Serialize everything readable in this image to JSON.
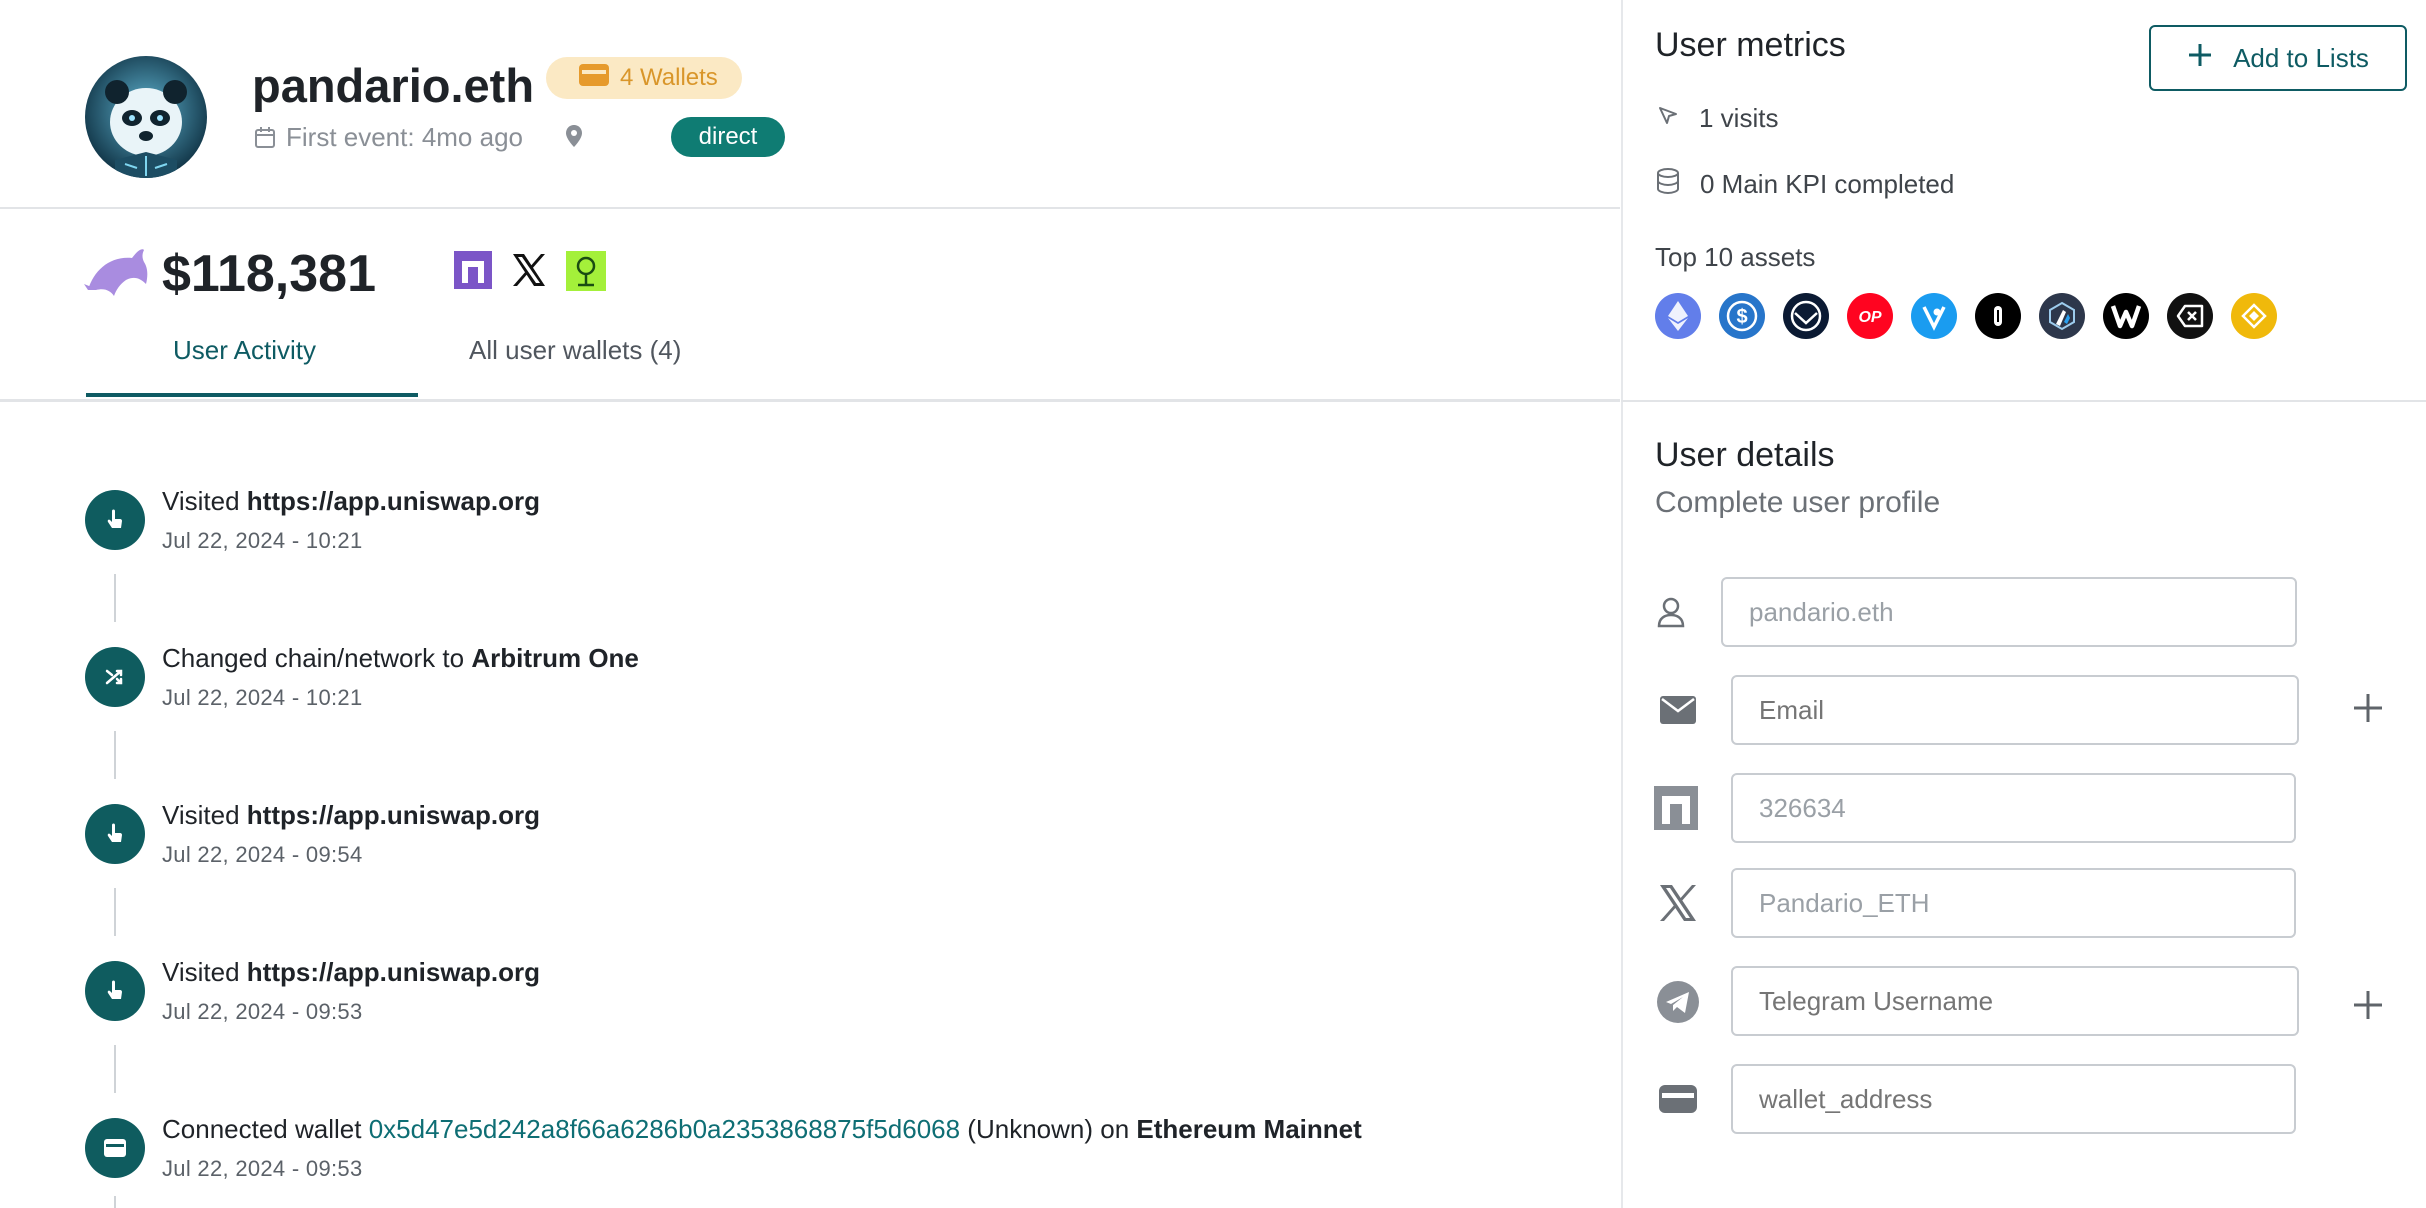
{
  "header": {
    "title": "pandario.eth",
    "wallets_badge": "4 Wallets",
    "first_event": "First event: 4mo ago",
    "source_badge": "direct"
  },
  "summary": {
    "amount": "$118,381",
    "social_icons": [
      "nouns-icon",
      "x-icon",
      "green-tree-icon"
    ]
  },
  "tabs": [
    {
      "label": "User Activity",
      "active": true
    },
    {
      "label": "All user wallets (4)",
      "active": false
    }
  ],
  "events": [
    {
      "icon": "click-icon",
      "prefix": "Visited ",
      "bold": "https://app.uniswap.org",
      "date": "Jul 22, 2024 - 10:21"
    },
    {
      "icon": "shuffle-icon",
      "prefix": "Changed chain/network to ",
      "bold": "Arbitrum One",
      "date": "Jul 22, 2024 - 10:21"
    },
    {
      "icon": "click-icon",
      "prefix": "Visited ",
      "bold": "https://app.uniswap.org",
      "date": "Jul 22, 2024 - 09:54"
    },
    {
      "icon": "click-icon",
      "prefix": "Visited ",
      "bold": "https://app.uniswap.org",
      "date": "Jul 22, 2024 - 09:53"
    },
    {
      "icon": "wallet-icon",
      "prefix": "Connected wallet ",
      "link": "0x5d47e5d242a8f66a6286b0a2353868875f5d6068",
      "middle": " (Unknown) on ",
      "bold": "Ethereum Mainnet",
      "date": "Jul 22, 2024 - 09:53"
    }
  ],
  "metrics": {
    "heading": "User metrics",
    "add_button": "Add to Lists",
    "visits": "1 visits",
    "kpi": "0 Main KPI completed",
    "top_assets_label": "Top 10 assets",
    "assets": [
      {
        "name": "ethereum-icon",
        "color": "#627eea"
      },
      {
        "name": "usdc-icon",
        "color": "#2775ca"
      },
      {
        "name": "gnosis-icon",
        "color": "#0b1a33"
      },
      {
        "name": "optimism-icon",
        "color": "#ff0420"
      },
      {
        "name": "velodrome-icon",
        "color": "#1a9cf0"
      },
      {
        "name": "token-black-icon",
        "color": "#000000"
      },
      {
        "name": "arbitrum-icon",
        "color": "#2d374b"
      },
      {
        "name": "wombat-icon",
        "color": "#000000"
      },
      {
        "name": "exchange-icon",
        "color": "#111111"
      },
      {
        "name": "binance-icon",
        "color": "#f0b90b"
      }
    ]
  },
  "details": {
    "heading": "User details",
    "subheading": "Complete user profile",
    "name_value": "pandario.eth",
    "email_placeholder": "Email",
    "nouns_value": "326634",
    "x_value": "Pandario_ETH",
    "telegram_placeholder": "Telegram Username",
    "wallet_placeholder": "wallet_address"
  }
}
